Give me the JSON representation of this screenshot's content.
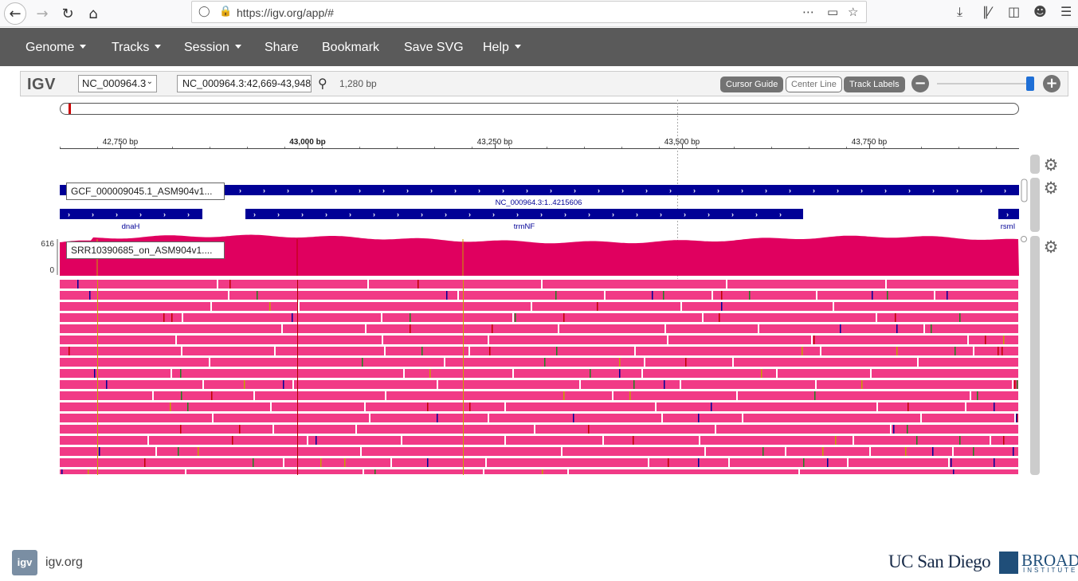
{
  "browser": {
    "url": "https://igv.org/app/#"
  },
  "navbar": {
    "items": [
      {
        "label": "Genome",
        "dropdown": true
      },
      {
        "label": "Tracks",
        "dropdown": true
      },
      {
        "label": "Session",
        "dropdown": true
      },
      {
        "label": "Share",
        "dropdown": false
      },
      {
        "label": "Bookmark",
        "dropdown": false
      },
      {
        "label": "Save SVG",
        "dropdown": false
      },
      {
        "label": "Help",
        "dropdown": true
      }
    ]
  },
  "igv": {
    "logo": "IGV",
    "genome": "NC_000964.3",
    "locus": "NC_000964.3:42,669-43,948",
    "width_label": "1,280 bp",
    "buttons": {
      "cursor_guide": "Cursor Guide",
      "center_line": "Center Line",
      "track_labels": "Track Labels"
    },
    "zoom_level": 1.0,
    "ruler_ticks": [
      "42,750 bp",
      "43,000 bp",
      "43,250 bp",
      "43,500 bp",
      "43,750 bp"
    ],
    "bold_tick": "43,000 bp"
  },
  "tracks": {
    "annotation": {
      "label": "GCF_000009045.1_ASM904v1...",
      "region_name": "NC_000964.3:1..4215606",
      "genes": [
        "dnaH",
        "trmNF",
        "rsmI"
      ]
    },
    "alignment": {
      "label": "SRR10390685_on_ASM904v1....",
      "coverage_max": "616",
      "coverage_min": "0"
    }
  },
  "colors": {
    "navbar": "#5a5a5a",
    "gene": "#000096",
    "coverage": "#e0005f",
    "reads": "#f13a86"
  },
  "footer": {
    "link": "igv.org",
    "logo_text": "igv",
    "ucsd": "UC San Diego",
    "broad": "BROAD",
    "broad_sub": "INSTITUTE"
  }
}
